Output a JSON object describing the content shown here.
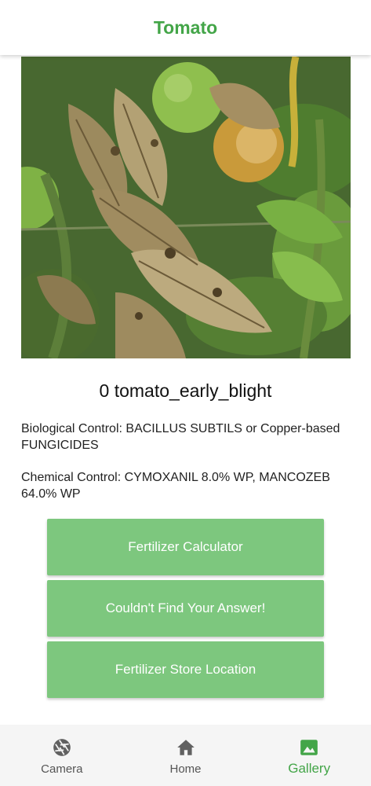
{
  "header": {
    "title": "Tomato"
  },
  "result": {
    "photo_icon": "tomato-leaf-photo",
    "disease_title": "0 tomato_early_blight",
    "biological_control": "Biological Control: BACILLUS SUBTILS or Copper-based FUNGICIDES",
    "chemical_control": "Chemical Control: CYMOXANIL 8.0% WP, MANCOZEB 64.0% WP"
  },
  "actions": {
    "fertilizer_calculator_label": "Fertilizer Calculator",
    "couldnt_find_label": "Couldn't Find Your Answer!",
    "store_location_label": "Fertilizer Store Location"
  },
  "bottom_nav": {
    "items": [
      {
        "label": "Camera",
        "icon": "camera-aperture-icon"
      },
      {
        "label": "Home",
        "icon": "home-icon"
      },
      {
        "label": "Gallery",
        "icon": "image-icon"
      }
    ],
    "active": "Gallery"
  },
  "colors": {
    "brand_green": "#43a548",
    "button_green": "#7dc77e",
    "nav_background": "#f5f5f5"
  }
}
